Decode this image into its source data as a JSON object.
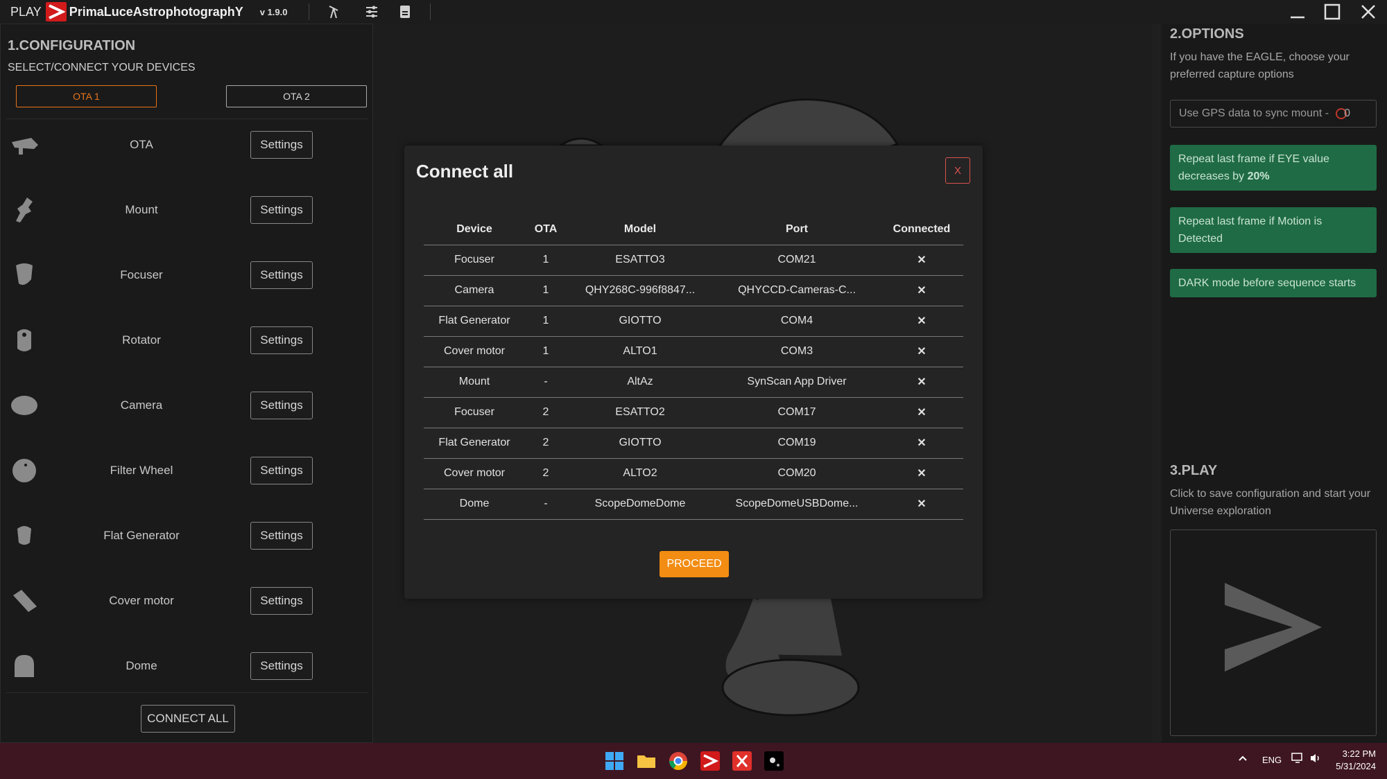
{
  "app": {
    "play_label": "PLAY",
    "brand": "PrimaLuceAstrophotographY",
    "version": "v 1.9.0"
  },
  "config": {
    "heading": "1.CONFIGURATION",
    "subheading": "SELECT/CONNECT YOUR DEVICES",
    "tabs": [
      "OTA 1",
      "OTA 2"
    ],
    "active_tab": "OTA 1",
    "devices": [
      {
        "name": "OTA",
        "button": "Settings"
      },
      {
        "name": "Mount",
        "button": "Settings"
      },
      {
        "name": "Focuser",
        "button": "Settings"
      },
      {
        "name": "Rotator",
        "button": "Settings"
      },
      {
        "name": "Camera",
        "button": "Settings"
      },
      {
        "name": "Filter Wheel",
        "button": "Settings"
      },
      {
        "name": "Flat Generator",
        "button": "Settings"
      },
      {
        "name": "Cover motor",
        "button": "Settings"
      },
      {
        "name": "Dome",
        "button": "Settings"
      }
    ],
    "connect_all_label": "CONNECT ALL"
  },
  "modal": {
    "title": "Connect all",
    "close_label": "X",
    "columns": [
      "Device",
      "OTA",
      "Model",
      "Port",
      "Connected"
    ],
    "rows": [
      {
        "device": "Focuser",
        "ota": "1",
        "model": "ESATTO3",
        "port": "COM21",
        "connected": "✕"
      },
      {
        "device": "Camera",
        "ota": "1",
        "model": "QHY268C-996f8847...",
        "port": "QHYCCD-Cameras-C...",
        "connected": "✕"
      },
      {
        "device": "Flat Generator",
        "ota": "1",
        "model": "GIOTTO",
        "port": "COM4",
        "connected": "✕"
      },
      {
        "device": "Cover motor",
        "ota": "1",
        "model": "ALTO1",
        "port": "COM3",
        "connected": "✕"
      },
      {
        "device": "Mount",
        "ota": "-",
        "model": "AltAz",
        "port": "SynScan App Driver",
        "connected": "✕"
      },
      {
        "device": "Focuser",
        "ota": "2",
        "model": "ESATTO2",
        "port": "COM17",
        "connected": "✕"
      },
      {
        "device": "Flat Generator",
        "ota": "2",
        "model": "GIOTTO",
        "port": "COM19",
        "connected": "✕"
      },
      {
        "device": "Cover motor",
        "ota": "2",
        "model": "ALTO2",
        "port": "COM20",
        "connected": "✕"
      },
      {
        "device": "Dome",
        "ota": "-",
        "model": "ScopeDomeDome",
        "port": "ScopeDomeUSBDome...",
        "connected": "✕"
      }
    ],
    "proceed_label": "PROCEED"
  },
  "options": {
    "heading": "2.OPTIONS",
    "description": "If you have the EAGLE, choose your preferred capture options",
    "gps_label": "Use GPS data to sync mount  -",
    "gps_value": "0",
    "repeat_eye_text": "Repeat last frame if EYE value decreases by",
    "repeat_eye_value": "20%",
    "repeat_motion": "Repeat last frame if Motion is Detected",
    "dark_mode": "DARK mode before sequence starts"
  },
  "play": {
    "heading": "3.PLAY",
    "description": "Click to save configuration and start your Universe exploration"
  },
  "taskbar": {
    "lang": "ENG",
    "time": "3:22 PM",
    "date": "5/31/2024"
  },
  "colors": {
    "accent": "#f28c12",
    "ota_active": "#e8741a",
    "error": "#e0302a",
    "option_green": "#1f6b45",
    "taskbar": "#3e1622"
  }
}
